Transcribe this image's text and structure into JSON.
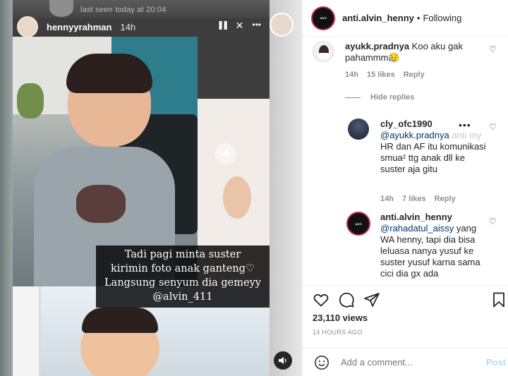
{
  "story": {
    "ghost_status": "last seen today at 20:04",
    "username": "hennyyrahman",
    "time": "14h",
    "caption_lines": [
      "Tadi pagi minta suster",
      "kirimin foto anak ganteng♡",
      "Langsung senyum dia gemeyy",
      "@alvin_411"
    ],
    "controls": {
      "pause": "❚❚",
      "mute": "✕",
      "more": "•••"
    },
    "share_icon": "share-icon",
    "volume_icon": "volume-icon"
  },
  "post": {
    "author": "anti.alvin_henny",
    "separator": "•",
    "follow_status": "Following",
    "avatar_text": "ANTI"
  },
  "comments": [
    {
      "user": "ayukk.pradnya",
      "text": "Koo aku gak pahammm😥",
      "time": "14h",
      "likes": "15 likes",
      "reply": "Reply"
    },
    {
      "user": "cly_ofc1990",
      "mention": "@ayukk.pradnya",
      "text_faint": "anti my",
      "text": "HR dan AF itu komunikasi smua² ttg anak dll ke suster aja gitu",
      "time": "14h",
      "likes": "7 likes",
      "reply": "Reply"
    },
    {
      "user": "anti.alvin_henny",
      "mention": "@rahadatul_aissy",
      "text": "yang WA henny, tapi dia bisa leluasa nanya yusuf ke suster yusuf karna sama cici dia gx ada"
    }
  ],
  "hide_replies": "Hide replies",
  "stats": {
    "views": "23,110 views",
    "ago": "14 HOURS AGO"
  },
  "add_comment": {
    "placeholder": "Add a comment...",
    "post_label": "Post"
  },
  "colors": {
    "mention": "#00376b",
    "post_button": "#b3dbff",
    "avatar_ring": "#c62a5b"
  }
}
